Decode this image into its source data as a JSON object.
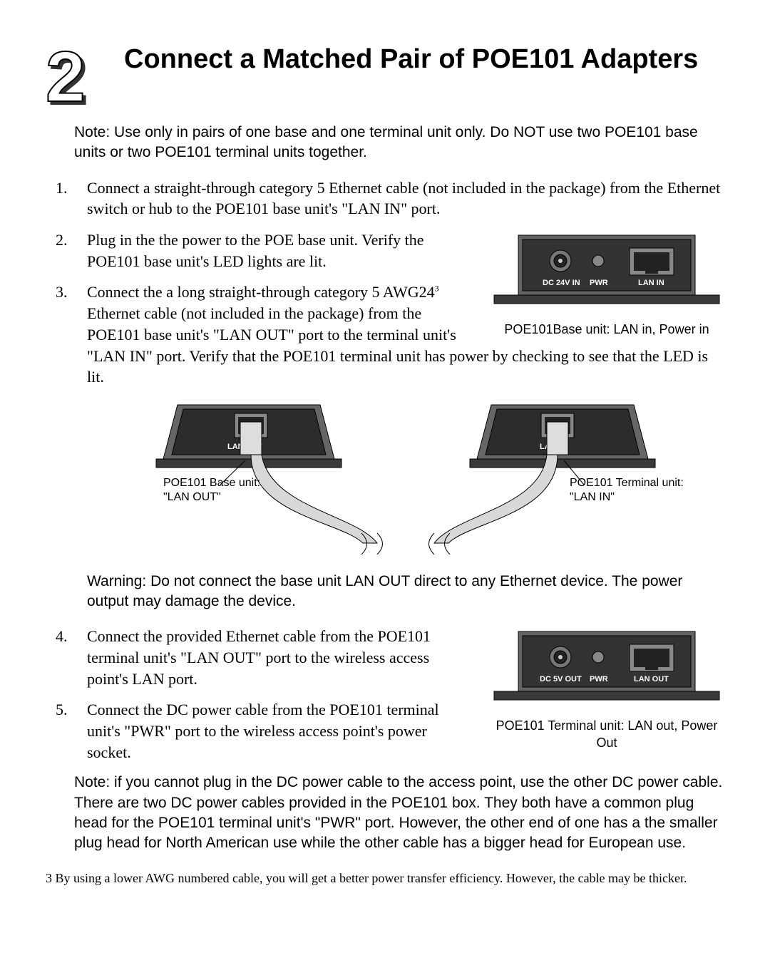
{
  "step_number": "2",
  "heading": "Connect a Matched Pair of POE101 Adapters",
  "top_note": "Note: Use only in pairs of one base and one terminal unit only. Do NOT use two POE101 base units or two POE101 terminal units together.",
  "steps": {
    "s1": "Connect a straight-through category 5 Ethernet cable (not included in the package) from the Ethernet switch or hub to the POE101 base unit's \"LAN IN\" port.",
    "s2": "Plug in the the power to the POE base unit. Verify the POE101 base unit's LED lights are lit.",
    "s3a": "Connect the a long straight-through category 5 AWG24",
    "s3sup": "3",
    "s3b": " Ethernet cable (not included in the package) from the POE101 base unit's \"LAN OUT\" port to the terminal unit's \"LAN IN\" port. Verify that the POE101 terminal unit has power by checking to see that the LED is lit.",
    "s4": "Connect the provided Ethernet cable from the POE101 terminal unit's \"LAN OUT\" port to the wireless access point's LAN port.",
    "s5": "Connect the DC power cable from the POE101 terminal unit's \"PWR\" port to the wireless access point's power socket."
  },
  "fig1": {
    "caption": "POE101Base unit: LAN in, Power in",
    "dc": "DC 24V IN",
    "pwr": "PWR",
    "lan": "LAN IN"
  },
  "fig2": {
    "left_port": "LAN OUT",
    "right_port": "LAN IN",
    "left_label_l1": "POE101 Base unit:",
    "left_label_l2": "\"LAN OUT\"",
    "right_label_l1": "POE101 Terminal unit:",
    "right_label_l2": "\"LAN IN\""
  },
  "warning": "Warning: Do not connect the base unit LAN OUT direct to any Ethernet device. The power output may damage the device.",
  "fig3": {
    "caption": "POE101 Terminal unit: LAN out, Power Out",
    "dc": "DC 5V OUT",
    "pwr": "PWR",
    "lan": "LAN OUT"
  },
  "bottom_note": "Note: if you cannot plug in the DC power cable to the access point, use the other DC power cable. There are two DC power cables provided in the POE101 box. They both have a common plug head for the POE101 terminal unit's \"PWR\" port. However, the other end of one has a the smaller plug head for North American use while the other cable has a bigger head for European use.",
  "footnote_num": "3",
  "footnote": " By using a lower AWG numbered cable, you will get a better power transfer efficiency. However, the cable may be thicker."
}
